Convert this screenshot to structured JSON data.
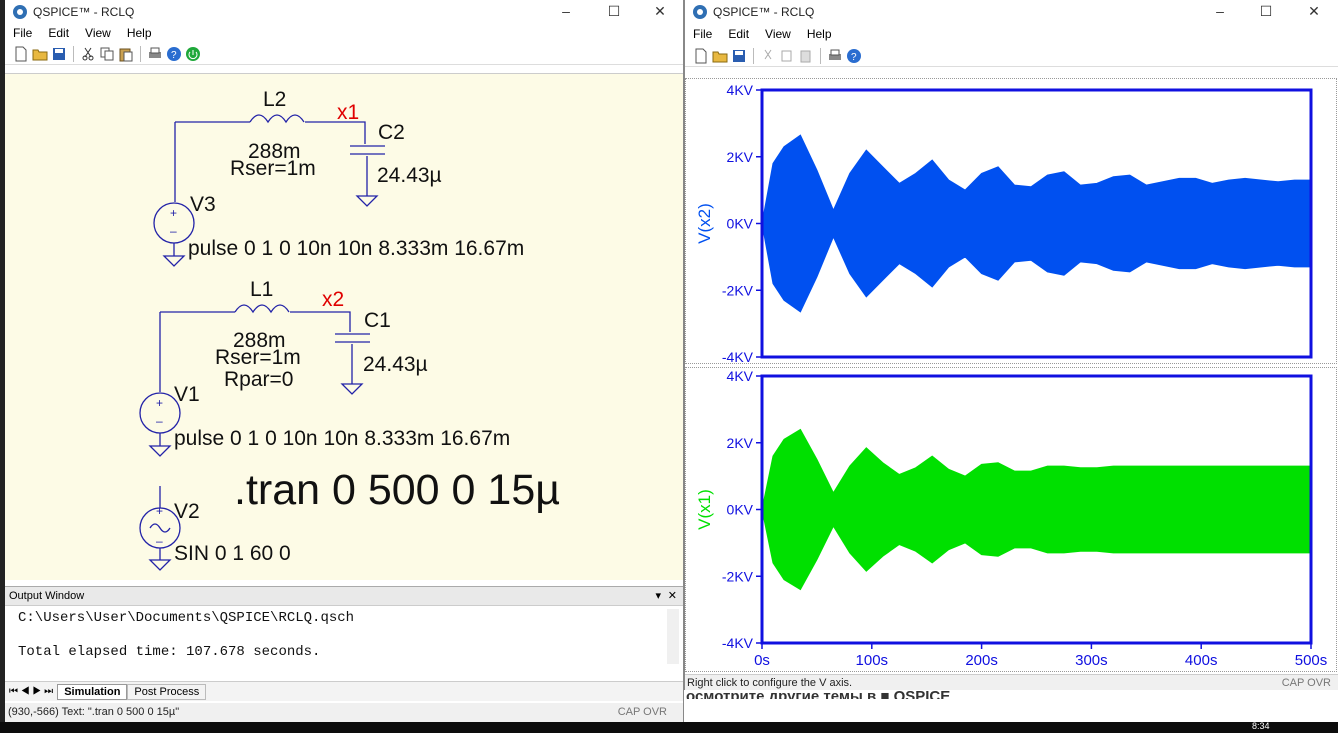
{
  "win1": {
    "title": "QSPICE™ - RCLQ",
    "menu": [
      "File",
      "Edit",
      "View",
      "Help"
    ]
  },
  "win2": {
    "title": "QSPICE™ - RCLQ",
    "menu": [
      "File",
      "Edit",
      "View",
      "Help"
    ]
  },
  "schematic": {
    "L2": "L2",
    "L2_val": "288m",
    "L2_rser": "Rser=1m",
    "x1": "x1",
    "C2": "C2",
    "C2_val": "24.43µ",
    "V3": "V3",
    "V3_src": "pulse 0 1 0 10n 10n 8.333m 16.67m",
    "L1": "L1",
    "L1_val": "288m",
    "L1_rser": "Rser=1m",
    "L1_rpar": "Rpar=0",
    "x2": "x2",
    "C1": "C1",
    "C1_val": "24.43µ",
    "V1": "V1",
    "V1_src": "pulse 0 1 0 10n 10n 8.333m 16.67m",
    "V2": "V2",
    "V2_src": "SIN 0 1 60 0",
    "tran": ".tran 0  500 0 15µ"
  },
  "output": {
    "title": "Output Window",
    "lines": [
      "C:\\Users\\User\\Documents\\QSPICE\\RCLQ.qsch",
      "Total elapsed time: 107.678 seconds."
    ]
  },
  "tabs": [
    "Simulation",
    "Post Process"
  ],
  "status1": "(930,-566) Text: \".tran 0  500 0 15µ\"",
  "caps": "CAP  OVR",
  "status2": "Right click to configure the V axis.",
  "web_text": "осмотрите другие темы в ■ QSPICE",
  "taskbar_time": "8:34",
  "chart_data": [
    {
      "type": "line",
      "ylabel": "V(x2)",
      "yticks": [
        "4KV",
        "2KV",
        "0KV",
        "-2KV",
        "-4KV"
      ],
      "ylim": [
        -4000,
        4000
      ],
      "color": "#0050f0",
      "xlim": [
        0,
        500
      ],
      "envelope": {
        "x": [
          0,
          10,
          20,
          35,
          50,
          65,
          80,
          95,
          110,
          125,
          140,
          155,
          170,
          185,
          200,
          215,
          230,
          245,
          260,
          275,
          290,
          305,
          320,
          335,
          350,
          365,
          380,
          395,
          410,
          425,
          440,
          455,
          470,
          485,
          500
        ],
        "amp": [
          0,
          1800,
          2300,
          2650,
          1600,
          400,
          1500,
          2200,
          1700,
          1200,
          1500,
          1900,
          1300,
          1000,
          1500,
          1700,
          1150,
          1100,
          1450,
          1550,
          1150,
          1200,
          1400,
          1450,
          1150,
          1250,
          1350,
          1350,
          1200,
          1300,
          1350,
          1300,
          1250,
          1300,
          1300
        ]
      }
    },
    {
      "type": "line",
      "ylabel": "V(x1)",
      "yticks": [
        "4KV",
        "2KV",
        "0KV",
        "-2KV",
        "-4KV"
      ],
      "ylim": [
        -4000,
        4000
      ],
      "xticks": [
        "0s",
        "100s",
        "200s",
        "300s",
        "400s",
        "500s"
      ],
      "color": "#00e000",
      "xlim": [
        0,
        500
      ],
      "envelope": {
        "x": [
          0,
          10,
          20,
          35,
          50,
          65,
          80,
          95,
          110,
          125,
          140,
          155,
          170,
          185,
          200,
          215,
          230,
          245,
          260,
          275,
          290,
          305,
          320,
          335,
          350,
          365,
          380,
          395,
          410,
          425,
          440,
          455,
          470,
          485,
          500
        ],
        "amp": [
          0,
          1600,
          2100,
          2400,
          1500,
          500,
          1300,
          1850,
          1400,
          1050,
          1250,
          1600,
          1200,
          1000,
          1350,
          1400,
          1150,
          1150,
          1300,
          1300,
          1250,
          1250,
          1300,
          1300,
          1300,
          1300,
          1300,
          1300,
          1300,
          1300,
          1300,
          1300,
          1300,
          1300,
          1300
        ]
      }
    }
  ]
}
